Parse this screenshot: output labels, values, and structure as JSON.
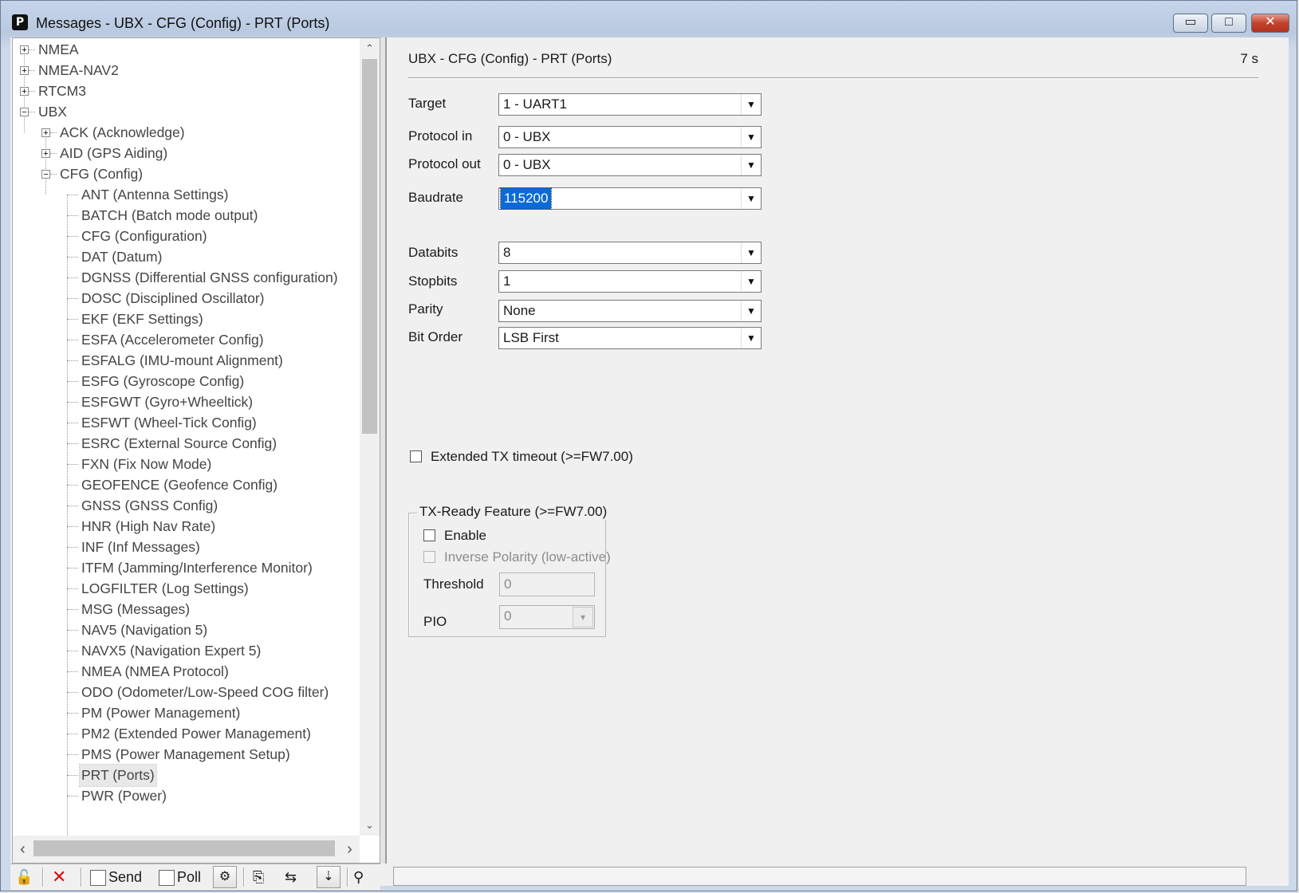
{
  "window": {
    "title": "Messages - UBX - CFG (Config) - PRT (Ports)",
    "minimize_glyph": "▭",
    "maximize_glyph": "□",
    "close_glyph": "✕"
  },
  "tree": {
    "items": [
      {
        "label": "NMEA",
        "level": 0,
        "expander": "+"
      },
      {
        "label": "NMEA-NAV2",
        "level": 0,
        "expander": "+"
      },
      {
        "label": "RTCM3",
        "level": 0,
        "expander": "+"
      },
      {
        "label": "UBX",
        "level": 0,
        "expander": "−"
      },
      {
        "label": "ACK (Acknowledge)",
        "level": 1,
        "expander": "+"
      },
      {
        "label": "AID (GPS Aiding)",
        "level": 1,
        "expander": "+"
      },
      {
        "label": "CFG (Config)",
        "level": 1,
        "expander": "−"
      },
      {
        "label": "ANT (Antenna Settings)",
        "level": 2
      },
      {
        "label": "BATCH (Batch mode output)",
        "level": 2
      },
      {
        "label": "CFG (Configuration)",
        "level": 2
      },
      {
        "label": "DAT (Datum)",
        "level": 2
      },
      {
        "label": "DGNSS (Differential GNSS configuration)",
        "level": 2
      },
      {
        "label": "DOSC (Disciplined Oscillator)",
        "level": 2
      },
      {
        "label": "EKF (EKF Settings)",
        "level": 2
      },
      {
        "label": "ESFA (Accelerometer Config)",
        "level": 2
      },
      {
        "label": "ESFALG (IMU-mount Alignment)",
        "level": 2
      },
      {
        "label": "ESFG (Gyroscope Config)",
        "level": 2
      },
      {
        "label": "ESFGWT (Gyro+Wheeltick)",
        "level": 2
      },
      {
        "label": "ESFWT (Wheel-Tick Config)",
        "level": 2
      },
      {
        "label": "ESRC (External Source Config)",
        "level": 2
      },
      {
        "label": "FXN (Fix Now Mode)",
        "level": 2
      },
      {
        "label": "GEOFENCE (Geofence Config)",
        "level": 2
      },
      {
        "label": "GNSS (GNSS Config)",
        "level": 2
      },
      {
        "label": "HNR (High Nav Rate)",
        "level": 2
      },
      {
        "label": "INF (Inf Messages)",
        "level": 2
      },
      {
        "label": "ITFM (Jamming/Interference Monitor)",
        "level": 2
      },
      {
        "label": "LOGFILTER (Log Settings)",
        "level": 2
      },
      {
        "label": "MSG (Messages)",
        "level": 2
      },
      {
        "label": "NAV5 (Navigation 5)",
        "level": 2
      },
      {
        "label": "NAVX5 (Navigation Expert 5)",
        "level": 2
      },
      {
        "label": "NMEA (NMEA Protocol)",
        "level": 2
      },
      {
        "label": "ODO (Odometer/Low-Speed COG filter)",
        "level": 2
      },
      {
        "label": "PM (Power Management)",
        "level": 2
      },
      {
        "label": "PM2 (Extended Power Management)",
        "level": 2
      },
      {
        "label": "PMS (Power Management Setup)",
        "level": 2
      },
      {
        "label": "PRT (Ports)",
        "level": 2,
        "selected": true
      },
      {
        "label": "PWR (Power)",
        "level": 2
      }
    ],
    "scroll_up": "⌃",
    "scroll_down": "⌄",
    "scroll_left": "‹",
    "scroll_right": "›"
  },
  "panel": {
    "title": "UBX - CFG (Config) - PRT (Ports)",
    "age": "7 s",
    "target": {
      "label": "Target",
      "value": "1 - UART1"
    },
    "protocol_in": {
      "label": "Protocol in",
      "value": "0 - UBX"
    },
    "protocol_out": {
      "label": "Protocol out",
      "value": "0 - UBX"
    },
    "baudrate": {
      "label": "Baudrate",
      "value": "115200"
    },
    "databits": {
      "label": "Databits",
      "value": "8"
    },
    "stopbits": {
      "label": "Stopbits",
      "value": "1"
    },
    "parity": {
      "label": "Parity",
      "value": "None"
    },
    "bit_order": {
      "label": "Bit Order",
      "value": "LSB First"
    },
    "extended_tx": {
      "label": "Extended TX timeout (>=FW7.00)",
      "checked": false
    },
    "tx_ready": {
      "group_title": "TX-Ready Feature (>=FW7.00)",
      "enable_label": "Enable",
      "inverse_label": "Inverse Polarity (low-active)",
      "threshold_label": "Threshold",
      "threshold_value": "0",
      "pio_label": "PIO",
      "pio_value": "0"
    }
  },
  "toolbar": {
    "send_label": "Send",
    "poll_label": "Poll"
  },
  "colors": {
    "selection": "#0a6ad6",
    "close_button": "#c2422d"
  }
}
